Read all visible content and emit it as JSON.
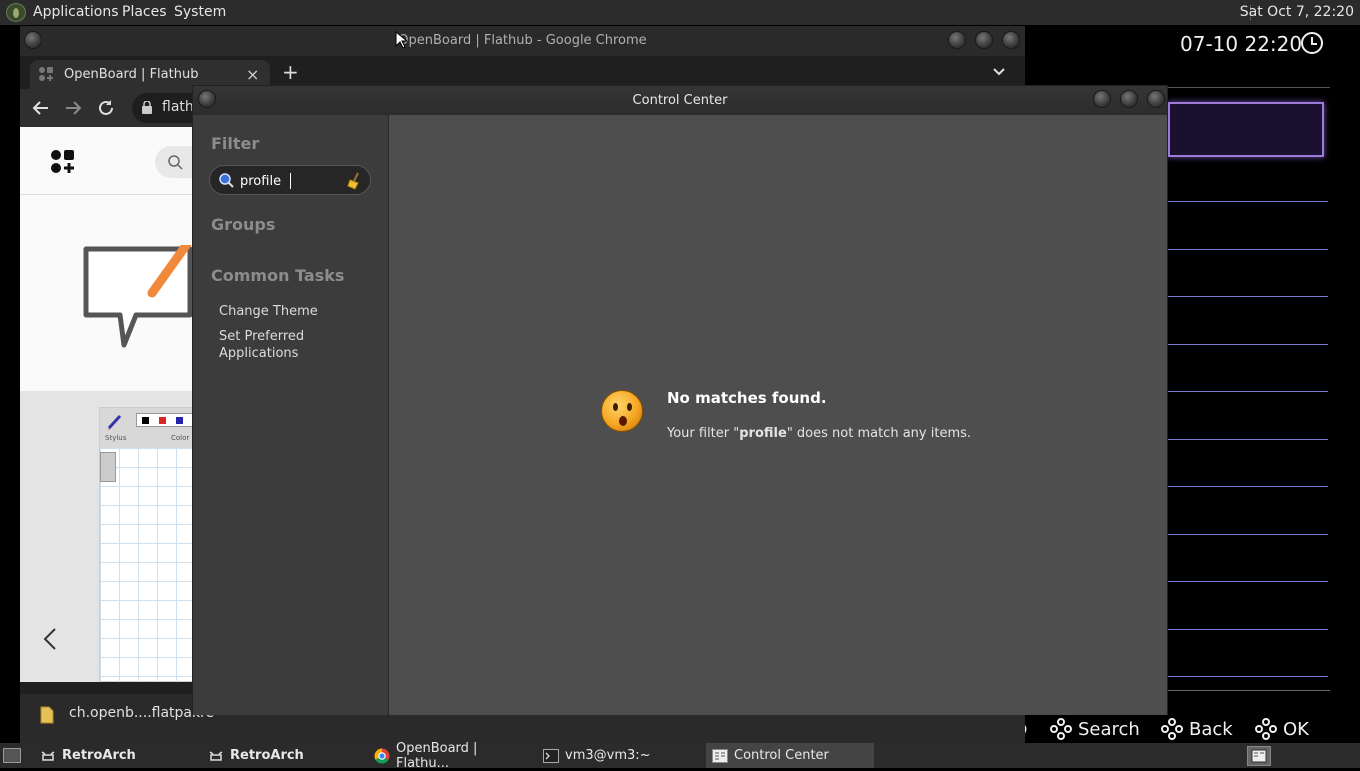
{
  "top_panel": {
    "menus": [
      "Applications",
      "Places",
      "System"
    ],
    "clock": "Sat Oct  7, 22:20"
  },
  "retroarch": {
    "clock": "07-10 22:20",
    "hints": {
      "search": "Search",
      "back": "Back",
      "ok": "OK",
      "partial": "b"
    },
    "accent": "#9b7ad8"
  },
  "chrome": {
    "window_title": "OpenBoard | Flathub - Google Chrome",
    "tab_title": "OpenBoard | Flathub",
    "tab_close": "×",
    "new_tab": "+",
    "url": "flath",
    "download_file": "ch.openb....flatpakre",
    "toolbar_label_stylus": "Stylus",
    "toolbar_label_color": "Color"
  },
  "control_center": {
    "title": "Control Center",
    "filter_heading": "Filter",
    "filter_value": "profile",
    "groups_heading": "Groups",
    "common_tasks_heading": "Common Tasks",
    "tasks": [
      "Change Theme",
      "Set Preferred Applications"
    ],
    "no_matches_title": "No matches found.",
    "no_matches_prefix": "Your filter \"",
    "no_matches_term": "profile",
    "no_matches_suffix": "\" does not match any items."
  },
  "taskbar": {
    "items": [
      "RetroArch",
      "RetroArch",
      "OpenBoard | Flathu...",
      "vm3@vm3:~",
      "Control Center"
    ]
  }
}
